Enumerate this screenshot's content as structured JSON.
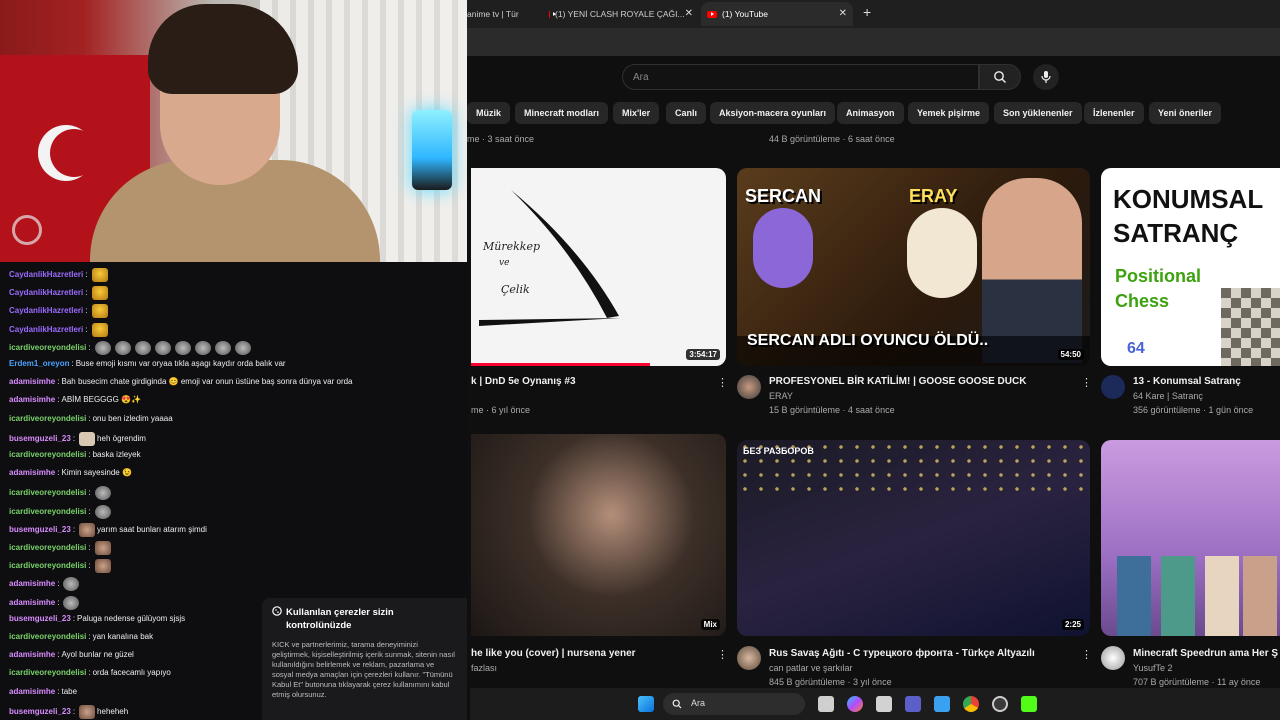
{
  "browser": {
    "tabs": [
      {
        "label": "anime tv | Tür",
        "active": false
      },
      {
        "label": "(1) YENİ CLASH ROYALE ÇAĞI...",
        "active": false
      },
      {
        "label": "(1) YouTube",
        "active": true
      }
    ]
  },
  "youtube": {
    "search_placeholder": "Ara",
    "chips": [
      "Müzik",
      "Minecraft modları",
      "Mix'ler",
      "Canlı",
      "Aksiyon-macera oyunları",
      "Animasyon",
      "Yemek pişirme",
      "Son yüklenenler",
      "İzlenenler",
      "Yeni öneriler"
    ],
    "top_meta": [
      "me · 3 saat önce",
      "44 B görüntüleme · 6 saat önce"
    ],
    "videos": [
      {
        "title": "k | DnD 5e Oynanış #3",
        "channel": "",
        "stats": "me · 6 yıl önce",
        "duration": "3:54:17",
        "thumb_text": [
          "Mürekkep",
          "ve",
          "Çelik"
        ]
      },
      {
        "title": "PROFESYONEL BİR KATİLİM! | GOOSE GOOSE DUCK",
        "channel": "ERAY",
        "stats": "15 B görüntüleme · 4 saat önce",
        "duration": "54:50",
        "thumb_text": [
          "SERCAN",
          "ERAY",
          "SERCAN ADLI OYUNCU ÖLDÜ.."
        ]
      },
      {
        "title": "13 - Konumsal Satranç",
        "channel": "64 Kare | Satranç",
        "stats": "356 görüntüleme · 1 gün önce",
        "duration": "",
        "thumb_text": [
          "KONUMSAL",
          "SATRANÇ",
          "Positional",
          "Chess",
          "64"
        ]
      },
      {
        "title": "he like you (cover) | nursena yener",
        "channel": "fazlası",
        "stats": "",
        "duration": "Mix",
        "thumb_text": []
      },
      {
        "title": "Rus Savaş Ağıtı - С турецкого фронта - Türkçe Altyazılı",
        "channel": "can patlar ve şarkılar",
        "stats": "845 B görüntüleme · 3 yıl önce",
        "duration": "2:25",
        "thumb_text": [
          "БЕЗ РАЗБОРОВ"
        ]
      },
      {
        "title": "Minecraft Speedrun ama Her Ş",
        "channel": "YusufTe 2",
        "stats": "707 B görüntüleme · 11 ay önce",
        "duration": "",
        "thumb_text": []
      }
    ]
  },
  "chat": {
    "messages": [
      {
        "user": "CaydanlikHazretleri",
        "color": "#9b6bff",
        "text": "",
        "emotes": [
          "gold"
        ]
      },
      {
        "user": "CaydanlikHazretleri",
        "color": "#9b6bff",
        "text": "",
        "emotes": [
          "gold"
        ]
      },
      {
        "user": "CaydanlikHazretleri",
        "color": "#9b6bff",
        "text": "",
        "emotes": [
          "gold"
        ]
      },
      {
        "user": "CaydanlikHazretleri",
        "color": "#9b6bff",
        "text": "",
        "emotes": [
          "gold"
        ]
      },
      {
        "user": "icardiveoreyondelisi",
        "color": "#7ad26b",
        "text": "",
        "emotes": [
          "grey",
          "grey",
          "grey",
          "grey",
          "grey",
          "grey",
          "grey",
          "grey"
        ]
      },
      {
        "user": "Erdem1_oreyon",
        "color": "#4aa3ff",
        "text": "Buse emoji kısmı var oryaa tıkla aşagı kaydır orda balık var",
        "emotes": []
      },
      {
        "user": "adamisimhe",
        "color": "#d98cff",
        "text": "Bah busecim chate girdiginda 😊 emoji var onun üstüne baş sonra dünya var orda",
        "emotes": []
      },
      {
        "user": "adamisimhe",
        "color": "#d98cff",
        "text": "ABİM BEGGGG 😍✨",
        "emotes": []
      },
      {
        "user": "icardiveoreyondelisi",
        "color": "#7ad26b",
        "text": "onu ben izledim yaaaa",
        "emotes": []
      },
      {
        "user": "busemguzeli_23",
        "color": "#d98cff",
        "text": "heh ögrendim",
        "emotes": [
          "pale"
        ]
      },
      {
        "user": "icardiveoreyondelisi",
        "color": "#7ad26b",
        "text": "baska izleyek",
        "emotes": []
      },
      {
        "user": "adamisimhe",
        "color": "#d98cff",
        "text": "Kimin sayesinde 😉",
        "emotes": []
      },
      {
        "user": "icardiveoreyondelisi",
        "color": "#7ad26b",
        "text": "",
        "emotes": [
          "grey"
        ]
      },
      {
        "user": "icardiveoreyondelisi",
        "color": "#7ad26b",
        "text": "",
        "emotes": [
          "grey"
        ]
      },
      {
        "user": "busemguzeli_23",
        "color": "#d98cff",
        "text": "yarım saat bunları atarım şimdi",
        "emotes": [
          "face"
        ]
      },
      {
        "user": "icardiveoreyondelisi",
        "color": "#7ad26b",
        "text": "",
        "emotes": [
          "face"
        ]
      },
      {
        "user": "icardiveoreyondelisi",
        "color": "#7ad26b",
        "text": "",
        "emotes": [
          "face"
        ]
      },
      {
        "user": "adamisimhe",
        "color": "#d98cff",
        "text": "",
        "emotes": [
          "grey"
        ]
      },
      {
        "user": "adamisimhe",
        "color": "#d98cff",
        "text": "",
        "emotes": [
          "grey"
        ]
      },
      {
        "user": "busemguzeli_23",
        "color": "#d98cff",
        "text": "Paluga nedense gülüyom sjsjs",
        "emotes": []
      },
      {
        "user": "icardiveoreyondelisi",
        "color": "#7ad26b",
        "text": "yan kanalına bak",
        "emotes": []
      },
      {
        "user": "adamisimhe",
        "color": "#d98cff",
        "text": "Ayol bunlar ne güzel",
        "emotes": []
      },
      {
        "user": "icardiveoreyondelisi",
        "color": "#7ad26b",
        "text": "orda facecamlı yapıyo",
        "emotes": []
      },
      {
        "user": "adamisimhe",
        "color": "#d98cff",
        "text": "tabe",
        "emotes": []
      },
      {
        "user": "busemguzeli_23",
        "color": "#d98cff",
        "text": "heheheh",
        "emotes": [
          "face"
        ]
      }
    ]
  },
  "cookie_notice": {
    "title": "Kullanılan çerezler sizin kontrolünüzde",
    "body": "KICK ve partnerlerimiz, tarama deneyiminizi geliştirmek, kişiselleştirilmiş içerik sunmak, sitenin nasıl kullanıldığını belirlemek ve reklam, pazarlama ve sosyal medya amaçları için çerezleri kullanır. \"Tümünü Kabul Et\" butonuna tıklayarak çerez kullanımını kabul etmiş olursunuz."
  },
  "taskbar": {
    "search_label": "Ara"
  }
}
